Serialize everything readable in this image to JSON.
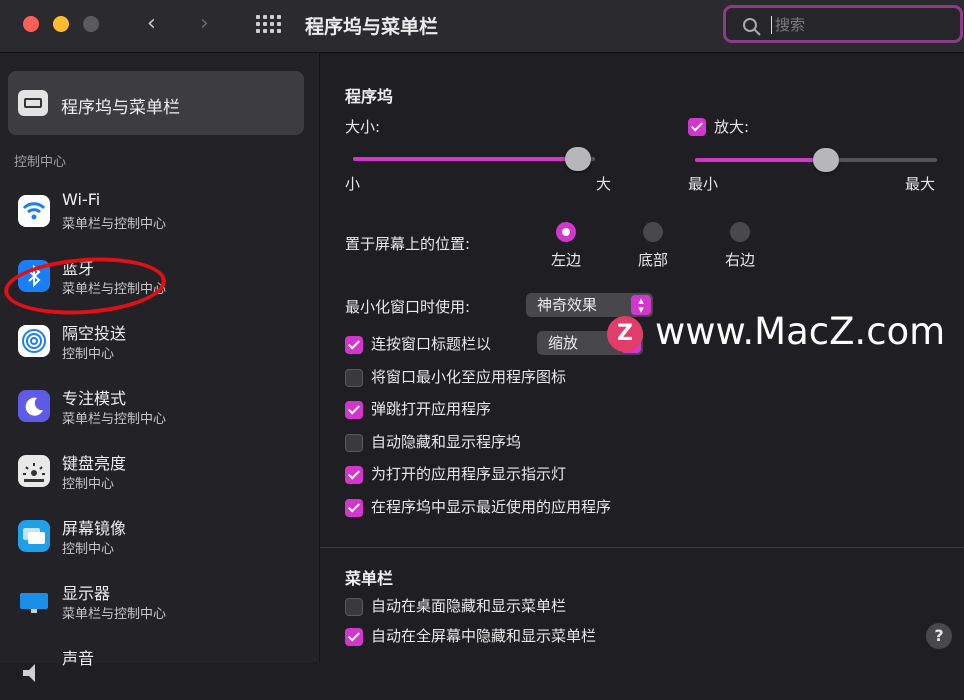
{
  "window": {
    "title": "程序坞与菜单栏",
    "back_glyph": "‹",
    "forward_glyph": "›",
    "search": {
      "placeholder": "搜索"
    },
    "traffic_lights": {
      "close": "#ff5f57",
      "minimize": "#febc2e",
      "zoom": "#5b5a5e"
    }
  },
  "sidebar": {
    "selected_item": {
      "label": "程序坞与菜单栏",
      "icon": "menubar-icon"
    },
    "section_header": "控制中心",
    "items": [
      {
        "label": "Wi-Fi",
        "sub": "菜单栏与控制中心",
        "icon": "wifi-icon",
        "color": "#1a7ff5"
      },
      {
        "label": "蓝牙",
        "sub": "菜单栏与控制中心",
        "icon": "bluetooth-icon",
        "color": "#1a7ff5",
        "glyph": "ʙ"
      },
      {
        "label": "隔空投送",
        "sub": "控制中心",
        "icon": "airdrop-icon",
        "color": "#1a7ff5"
      },
      {
        "label": "专注模式",
        "sub": "菜单栏与控制中心",
        "icon": "moon-icon",
        "color": "#5e5ce6"
      },
      {
        "label": "键盘亮度",
        "sub": "控制中心",
        "icon": "keyboard-brightness-icon",
        "color": "#e9e9ea"
      },
      {
        "label": "屏幕镜像",
        "sub": "控制中心",
        "icon": "screen-mirroring-icon",
        "color": "#1fa0e8"
      },
      {
        "label": "显示器",
        "sub": "菜单栏与控制中心",
        "icon": "display-icon",
        "color": "#1a8ee8"
      },
      {
        "label": "声音",
        "sub": "",
        "icon": "sound-icon",
        "color": "#232226"
      }
    ]
  },
  "dock": {
    "heading": "程序坞",
    "size": {
      "label": "大小:",
      "min": "小",
      "max": "大",
      "value_fraction": 0.93
    },
    "magnification": {
      "label": "放大:",
      "checked": true,
      "min": "最小",
      "max": "最大",
      "value_fraction": 0.54
    },
    "position": {
      "label": "置于屏幕上的位置:",
      "options": [
        {
          "label": "左边",
          "selected": true
        },
        {
          "label": "底部",
          "selected": false
        },
        {
          "label": "右边",
          "selected": false
        }
      ]
    },
    "minimize_using": {
      "label": "最小化窗口时使用:",
      "value": "神奇效果"
    },
    "double_click": {
      "label": "连按窗口标题栏以",
      "value": "缩放",
      "checked": true
    },
    "checkboxes": [
      {
        "label": "将窗口最小化至应用程序图标",
        "checked": false
      },
      {
        "label": "弹跳打开应用程序",
        "checked": true
      },
      {
        "label": "自动隐藏和显示程序坞",
        "checked": false
      },
      {
        "label": "为打开的应用程序显示指示灯",
        "checked": true
      },
      {
        "label": "在程序坞中显示最近使用的应用程序",
        "checked": true
      }
    ]
  },
  "menubar": {
    "heading": "菜单栏",
    "checkboxes": [
      {
        "label": "自动在桌面隐藏和显示菜单栏",
        "checked": false
      },
      {
        "label": "自动在全屏幕中隐藏和显示菜单栏",
        "checked": true
      }
    ]
  },
  "watermark": {
    "logo_letter": "Z",
    "text": "www.MacZ.com"
  },
  "help_label": "?",
  "accent_color": "#d236cc"
}
